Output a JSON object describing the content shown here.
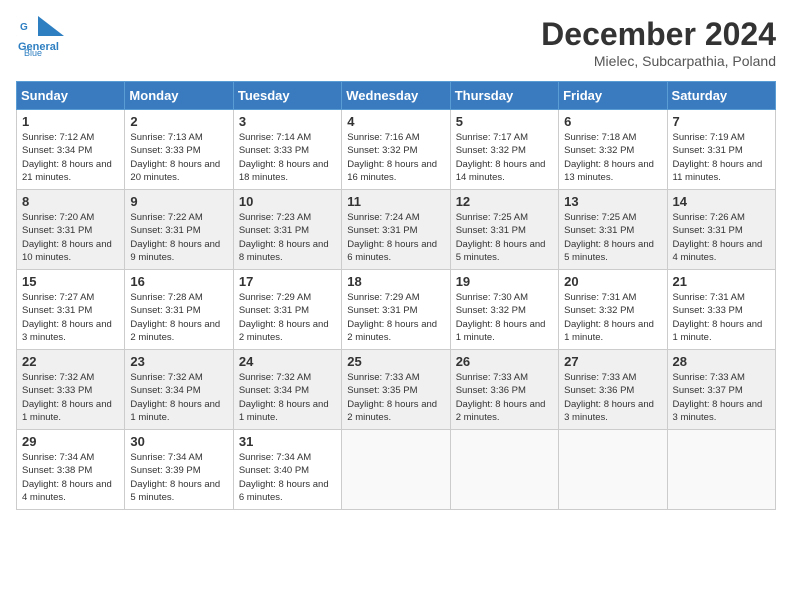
{
  "header": {
    "logo_line1": "General",
    "logo_line2": "Blue",
    "month": "December 2024",
    "location": "Mielec, Subcarpathia, Poland"
  },
  "days_of_week": [
    "Sunday",
    "Monday",
    "Tuesday",
    "Wednesday",
    "Thursday",
    "Friday",
    "Saturday"
  ],
  "weeks": [
    [
      {
        "day": 1,
        "sunrise": "7:12 AM",
        "sunset": "3:34 PM",
        "daylight": "8 hours and 21 minutes."
      },
      {
        "day": 2,
        "sunrise": "7:13 AM",
        "sunset": "3:33 PM",
        "daylight": "8 hours and 20 minutes."
      },
      {
        "day": 3,
        "sunrise": "7:14 AM",
        "sunset": "3:33 PM",
        "daylight": "8 hours and 18 minutes."
      },
      {
        "day": 4,
        "sunrise": "7:16 AM",
        "sunset": "3:32 PM",
        "daylight": "8 hours and 16 minutes."
      },
      {
        "day": 5,
        "sunrise": "7:17 AM",
        "sunset": "3:32 PM",
        "daylight": "8 hours and 14 minutes."
      },
      {
        "day": 6,
        "sunrise": "7:18 AM",
        "sunset": "3:32 PM",
        "daylight": "8 hours and 13 minutes."
      },
      {
        "day": 7,
        "sunrise": "7:19 AM",
        "sunset": "3:31 PM",
        "daylight": "8 hours and 11 minutes."
      }
    ],
    [
      {
        "day": 8,
        "sunrise": "7:20 AM",
        "sunset": "3:31 PM",
        "daylight": "8 hours and 10 minutes."
      },
      {
        "day": 9,
        "sunrise": "7:22 AM",
        "sunset": "3:31 PM",
        "daylight": "8 hours and 9 minutes."
      },
      {
        "day": 10,
        "sunrise": "7:23 AM",
        "sunset": "3:31 PM",
        "daylight": "8 hours and 8 minutes."
      },
      {
        "day": 11,
        "sunrise": "7:24 AM",
        "sunset": "3:31 PM",
        "daylight": "8 hours and 6 minutes."
      },
      {
        "day": 12,
        "sunrise": "7:25 AM",
        "sunset": "3:31 PM",
        "daylight": "8 hours and 5 minutes."
      },
      {
        "day": 13,
        "sunrise": "7:25 AM",
        "sunset": "3:31 PM",
        "daylight": "8 hours and 5 minutes."
      },
      {
        "day": 14,
        "sunrise": "7:26 AM",
        "sunset": "3:31 PM",
        "daylight": "8 hours and 4 minutes."
      }
    ],
    [
      {
        "day": 15,
        "sunrise": "7:27 AM",
        "sunset": "3:31 PM",
        "daylight": "8 hours and 3 minutes."
      },
      {
        "day": 16,
        "sunrise": "7:28 AM",
        "sunset": "3:31 PM",
        "daylight": "8 hours and 2 minutes."
      },
      {
        "day": 17,
        "sunrise": "7:29 AM",
        "sunset": "3:31 PM",
        "daylight": "8 hours and 2 minutes."
      },
      {
        "day": 18,
        "sunrise": "7:29 AM",
        "sunset": "3:31 PM",
        "daylight": "8 hours and 2 minutes."
      },
      {
        "day": 19,
        "sunrise": "7:30 AM",
        "sunset": "3:32 PM",
        "daylight": "8 hours and 1 minute."
      },
      {
        "day": 20,
        "sunrise": "7:31 AM",
        "sunset": "3:32 PM",
        "daylight": "8 hours and 1 minute."
      },
      {
        "day": 21,
        "sunrise": "7:31 AM",
        "sunset": "3:33 PM",
        "daylight": "8 hours and 1 minute."
      }
    ],
    [
      {
        "day": 22,
        "sunrise": "7:32 AM",
        "sunset": "3:33 PM",
        "daylight": "8 hours and 1 minute."
      },
      {
        "day": 23,
        "sunrise": "7:32 AM",
        "sunset": "3:34 PM",
        "daylight": "8 hours and 1 minute."
      },
      {
        "day": 24,
        "sunrise": "7:32 AM",
        "sunset": "3:34 PM",
        "daylight": "8 hours and 1 minute."
      },
      {
        "day": 25,
        "sunrise": "7:33 AM",
        "sunset": "3:35 PM",
        "daylight": "8 hours and 2 minutes."
      },
      {
        "day": 26,
        "sunrise": "7:33 AM",
        "sunset": "3:36 PM",
        "daylight": "8 hours and 2 minutes."
      },
      {
        "day": 27,
        "sunrise": "7:33 AM",
        "sunset": "3:36 PM",
        "daylight": "8 hours and 3 minutes."
      },
      {
        "day": 28,
        "sunrise": "7:33 AM",
        "sunset": "3:37 PM",
        "daylight": "8 hours and 3 minutes."
      }
    ],
    [
      {
        "day": 29,
        "sunrise": "7:34 AM",
        "sunset": "3:38 PM",
        "daylight": "8 hours and 4 minutes."
      },
      {
        "day": 30,
        "sunrise": "7:34 AM",
        "sunset": "3:39 PM",
        "daylight": "8 hours and 5 minutes."
      },
      {
        "day": 31,
        "sunrise": "7:34 AM",
        "sunset": "3:40 PM",
        "daylight": "8 hours and 6 minutes."
      },
      null,
      null,
      null,
      null
    ]
  ],
  "labels": {
    "sunrise": "Sunrise:",
    "sunset": "Sunset:",
    "daylight": "Daylight:"
  }
}
